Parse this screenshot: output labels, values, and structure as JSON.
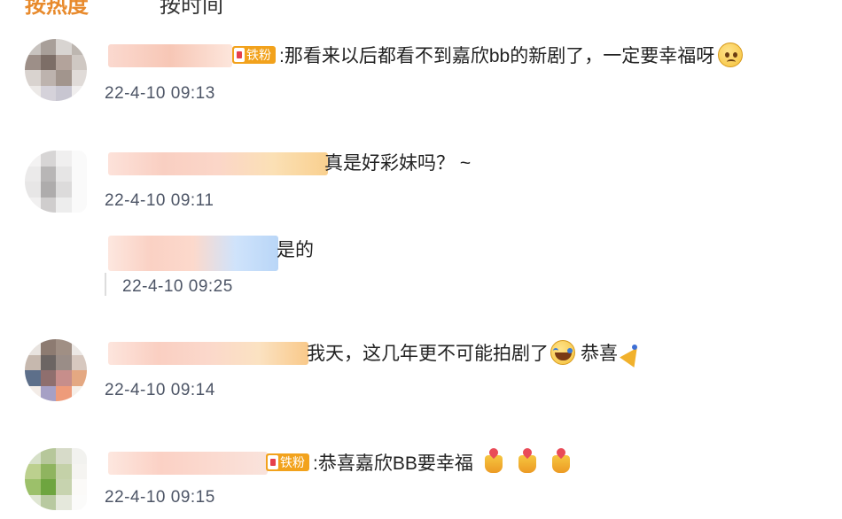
{
  "tabs": {
    "active": "按热度",
    "inactive": "按时间"
  },
  "colors": {
    "badge": "#f2a21c",
    "accent": "#e88a2c",
    "time": "#4d5566"
  },
  "comments": [
    {
      "badge": "铁粉",
      "text": ":那看来以后都看不到嘉欣bb的新剧了，一定要幸福呀",
      "emoji": "sad-face-icon",
      "time": "22-4-10 09:13"
    },
    {
      "text": "真是好彩妹吗？ ~",
      "time": "22-4-10 09:11"
    },
    {
      "text": "是的",
      "time": "22-4-10 09:25"
    },
    {
      "text": "我天，这几年更不可能拍剧了",
      "extra": "恭喜",
      "emoji": "laughing-crying-icon",
      "emoji2": "party-popper-icon",
      "time": "22-4-10 09:14"
    },
    {
      "badge": "铁粉",
      "text": ":恭喜嘉欣BB要幸福",
      "emoji": "cheer-hands-icon",
      "time": "22-4-10 09:15"
    }
  ]
}
